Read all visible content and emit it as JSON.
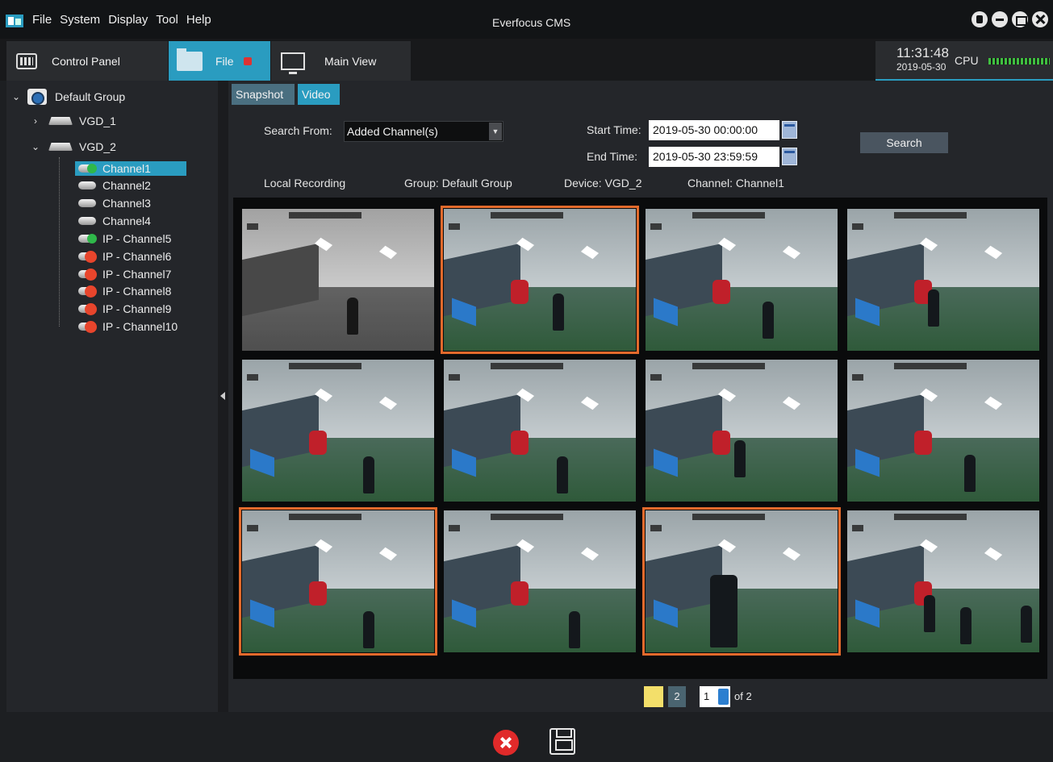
{
  "window": {
    "title": "Everfocus CMS"
  },
  "menu": [
    "File",
    "System",
    "Display",
    "Tool",
    "Help"
  ],
  "tabs": {
    "control_panel": "Control Panel",
    "file": "File",
    "main_view": "Main View"
  },
  "status": {
    "time": "11:31:48",
    "date": "2019-05-30",
    "cpu_label": "CPU",
    "accent": "#2a9cc0"
  },
  "tree": {
    "group": "Default Group",
    "devices": [
      "VGD_1",
      "VGD_2"
    ],
    "channels": [
      "Channel1",
      "Channel2",
      "Channel3",
      "Channel4",
      "IP - Channel5",
      "IP - Channel6",
      "IP - Channel7",
      "IP - Channel8",
      "IP - Channel9",
      "IP - Channel10"
    ],
    "selected_channel": "Channel1"
  },
  "subtabs": {
    "snapshot": "Snapshot",
    "video": "Video"
  },
  "search": {
    "from_label": "Search From:",
    "from_value": "Added Channel(s)",
    "start_label": "Start Time:",
    "start_value": "2019-05-30 00:00:00",
    "end_label": "End Time:",
    "end_value": "2019-05-30 23:59:59",
    "button": "Search"
  },
  "info": {
    "recording": "Local Recording",
    "group": "Group: Default Group",
    "device": "Device: VGD_2",
    "channel": "Channel: Channel1"
  },
  "pager": {
    "page1": "1",
    "page2": "2",
    "current": "1",
    "of": "of 2"
  }
}
